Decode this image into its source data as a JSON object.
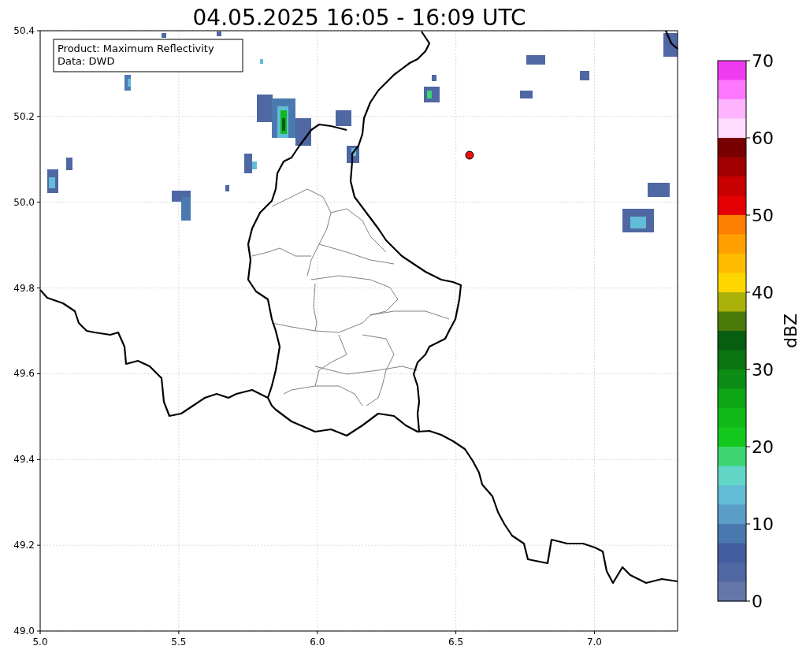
{
  "title": "04.05.2025 16:05 - 16:09 UTC",
  "info_box": [
    "Product: Maximum Reflectivity",
    "Data: DWD"
  ],
  "x_ticks": [
    "5.0",
    "5.5",
    "6.0",
    "6.5",
    "7.0"
  ],
  "y_ticks": [
    "50.4",
    "50.2",
    "50.0",
    "49.8",
    "49.6",
    "49.4",
    "49.2",
    "49.0"
  ],
  "colorbar": {
    "label": "dBZ",
    "ticks": [
      "70",
      "60",
      "50",
      "40",
      "30",
      "20",
      "10",
      "0"
    ],
    "segments": [
      {
        "color": "#f03cf0"
      },
      {
        "color": "#ff78ff"
      },
      {
        "color": "#ffb4ff"
      },
      {
        "color": "#ffdcff"
      },
      {
        "color": "#780000"
      },
      {
        "color": "#a00000"
      },
      {
        "color": "#c80000"
      },
      {
        "color": "#e40000"
      },
      {
        "color": "#ff8000"
      },
      {
        "color": "#ffa000"
      },
      {
        "color": "#ffbb00"
      },
      {
        "color": "#ffd700"
      },
      {
        "color": "#aab20a"
      },
      {
        "color": "#4a7a0a"
      },
      {
        "color": "#085e10"
      },
      {
        "color": "#0a7412"
      },
      {
        "color": "#0b8c14"
      },
      {
        "color": "#0ea516"
      },
      {
        "color": "#10b818"
      },
      {
        "color": "#14c81e"
      },
      {
        "color": "#3dd570"
      },
      {
        "color": "#62d6c6"
      },
      {
        "color": "#62bcd8"
      },
      {
        "color": "#5a9ec8"
      },
      {
        "color": "#4a79b0"
      },
      {
        "color": "#425ea0"
      },
      {
        "color": "#4f67a3"
      },
      {
        "color": "#6577a8"
      }
    ]
  }
}
